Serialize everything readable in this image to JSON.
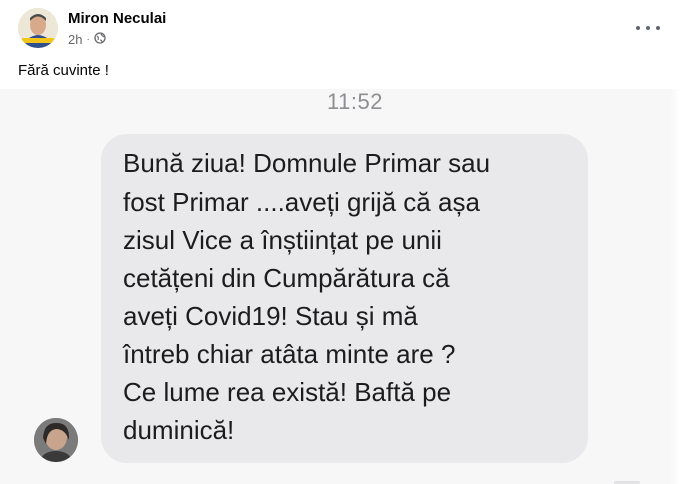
{
  "post": {
    "author": "Miron Neculai",
    "time": "2h",
    "text": "Fără cuvinte !",
    "audience_icon": "globe-icon",
    "menu_icon": "more-dots-icon"
  },
  "screenshot": {
    "time": "11:52",
    "message_lines": [
      "Bună ziua! Domnule Primar sau",
      "fost Primar ....aveți grijă că așa",
      "zisul Vice a înștiințat pe unii",
      "cetățeni din Cumpărătura că",
      "aveți Covid19! Stau și mă",
      "întreb chiar atâta minte are ?",
      "Ce lume rea există! Baftă pe",
      "duminică!"
    ]
  },
  "colors": {
    "bubble": "#e9e9eb",
    "meta_text": "#65676b",
    "timestamp": "#8e8e93"
  }
}
